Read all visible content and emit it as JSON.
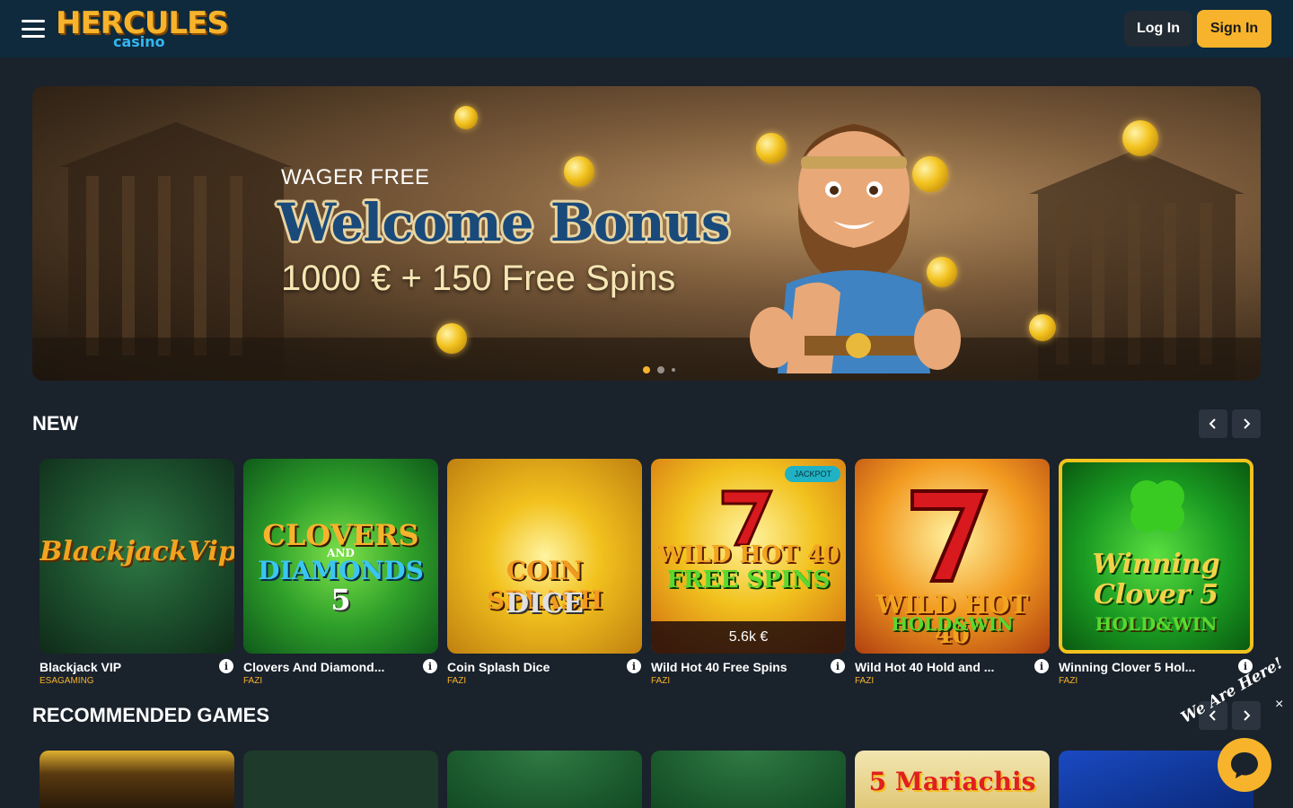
{
  "header": {
    "logo_main": "HERCULES",
    "logo_sub": "casino",
    "login_label": "Log In",
    "signin_label": "Sign In"
  },
  "banner": {
    "pretitle": "WAGER FREE",
    "title": "Welcome Bonus",
    "subtitle": "1000 € + 150 Free Spins",
    "slides": 3,
    "active_slide": 1
  },
  "sections": {
    "new": {
      "title": "NEW"
    },
    "recommended": {
      "title": "RECOMMENDED GAMES"
    }
  },
  "new_games": [
    {
      "title": "Blackjack VIP",
      "provider": "ESAGAMING",
      "thumb_text": "BlackjackVip"
    },
    {
      "title": "Clovers And Diamond...",
      "provider": "FAZI",
      "thumb_text_1": "CLOVERS",
      "thumb_text_2": "AND",
      "thumb_text_3": "DIAMONDS",
      "thumb_text_4": "5"
    },
    {
      "title": "Coin Splash Dice",
      "provider": "FAZI",
      "thumb_text_1": "COIN SPLASH",
      "thumb_text_2": "DICE"
    },
    {
      "title": "Wild Hot 40 Free Spins",
      "provider": "FAZI",
      "jackpot_label": "JACKPOT",
      "jackpot_amount": "5.6k €",
      "thumb_text_1": "WILD HOT 40",
      "thumb_text_2": "FREE SPINS"
    },
    {
      "title": "Wild Hot 40 Hold and ...",
      "provider": "FAZI",
      "thumb_text_1": "WILD HOT 40",
      "thumb_text_2": "HOLD&WIN"
    },
    {
      "title": "Winning Clover 5 Hol...",
      "provider": "FAZI",
      "thumb_text_1": "Winning",
      "thumb_text_2": "Clover 5",
      "thumb_text_3": "HOLD&WIN"
    }
  ],
  "recommended_games": [
    {
      "thumb_text": ""
    },
    {
      "thumb_text": ""
    },
    {
      "thumb_text": ""
    },
    {
      "thumb_text": ""
    },
    {
      "thumb_text": "5 Mariachis"
    },
    {
      "thumb_text": ""
    }
  ],
  "chat": {
    "label": "We Are Here!",
    "close": "×"
  },
  "colors": {
    "accent": "#f7b32b",
    "header_bg": "#0f2a3c",
    "page_bg": "#1a222c"
  },
  "icons": {
    "menu": "hamburger-icon",
    "prev": "chevron-left-icon",
    "next": "chevron-right-icon",
    "info": "info-icon",
    "chat": "chat-icon",
    "close": "close-icon"
  }
}
